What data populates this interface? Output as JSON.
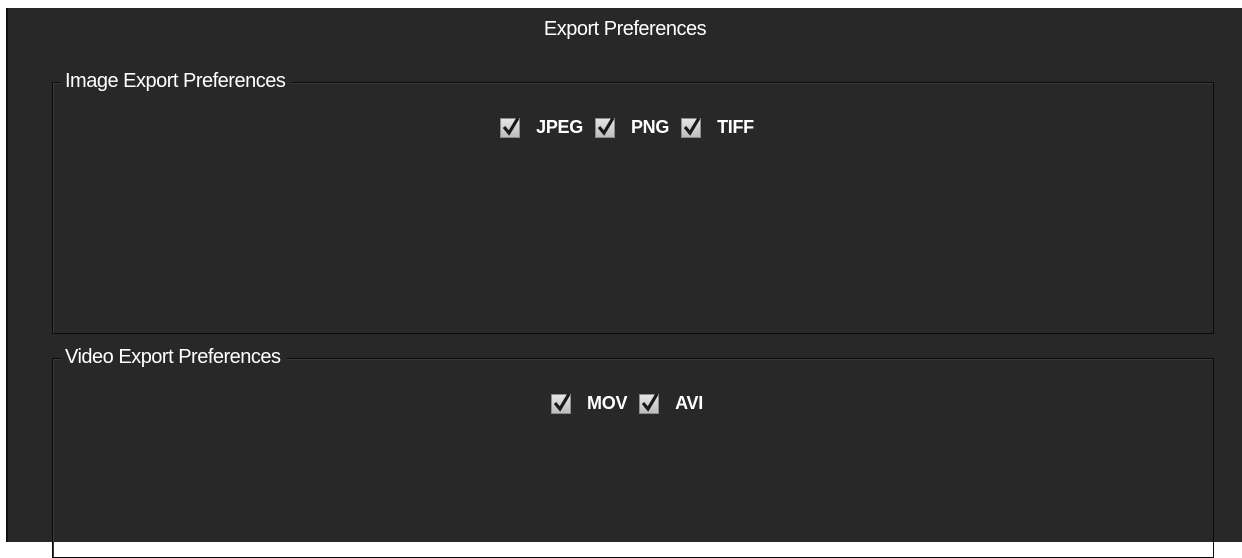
{
  "panel": {
    "title": "Export Preferences"
  },
  "image_export": {
    "title": "Image Export Preferences",
    "options": [
      {
        "label": "JPEG",
        "checked": true
      },
      {
        "label": "PNG",
        "checked": true
      },
      {
        "label": "TIFF",
        "checked": true
      }
    ]
  },
  "video_export": {
    "title": "Video Export Preferences",
    "options": [
      {
        "label": "MOV",
        "checked": true
      },
      {
        "label": "AVI",
        "checked": true
      }
    ]
  },
  "colors": {
    "background": "#282828",
    "text": "#ffffff",
    "checkbox": "#d9d9d9",
    "checkmark": "#1a1a1a"
  }
}
